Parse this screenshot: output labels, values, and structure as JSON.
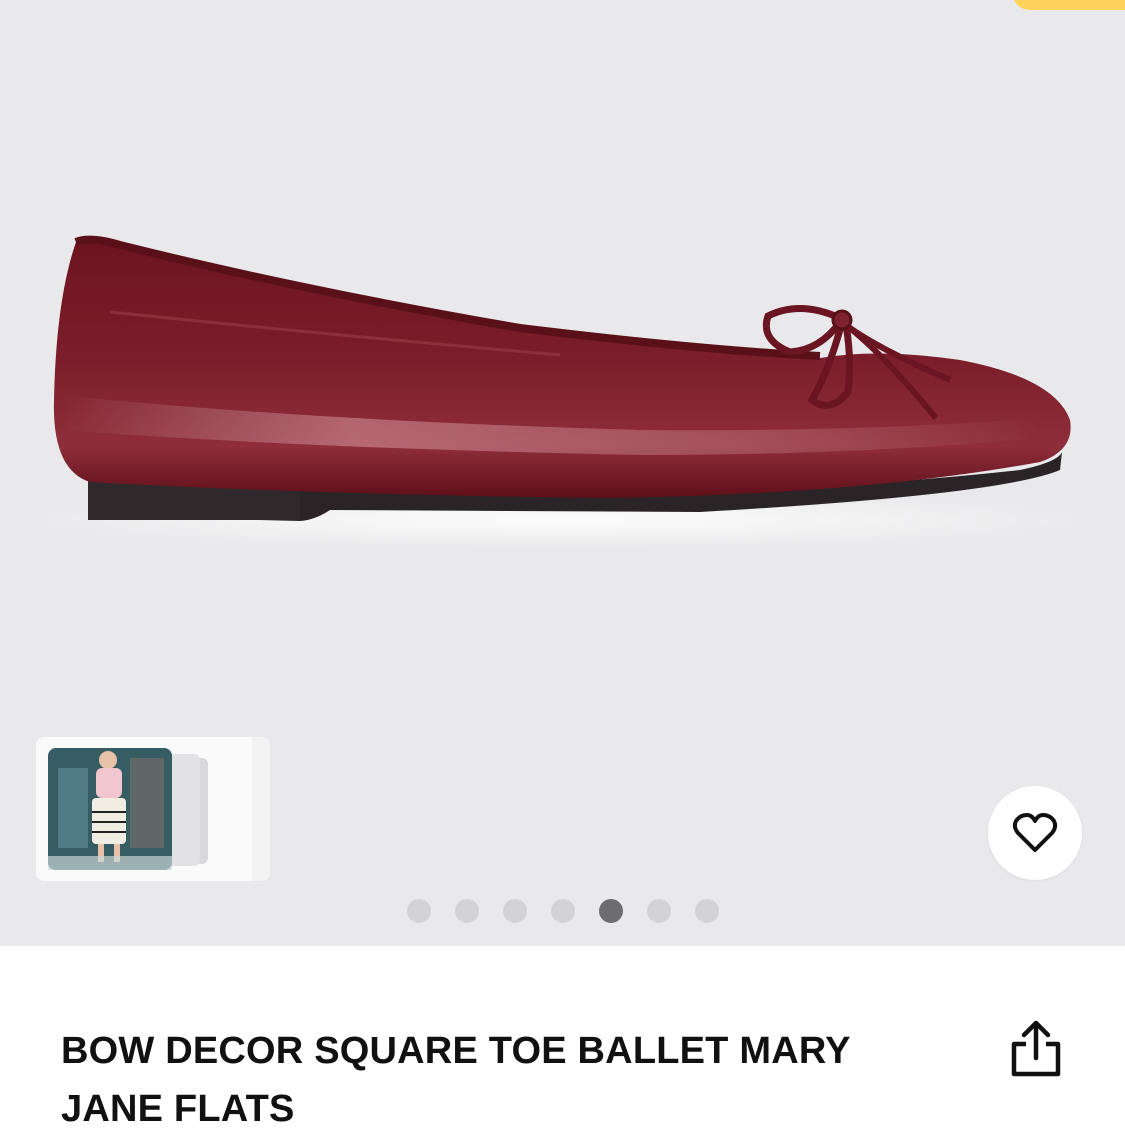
{
  "product": {
    "title": "BOW DECOR SQUARE TOE BALLET MARY JANE FLATS",
    "image": "burgundy-patent-ballet-flat-side-view",
    "color": "#7a1c28"
  },
  "gallery": {
    "thumbnail": "model-outfit-photo",
    "more_icon": "chevron-right-icon",
    "dots_total": 7,
    "active_dot_index": 4,
    "background": "#e9e9eb"
  },
  "actions": {
    "favorite_icon": "heart-icon",
    "share_icon": "share-icon"
  },
  "colors": {
    "accent": "#ffd35a",
    "dot_inactive": "#d3d3d6",
    "dot_active": "#6d6d70"
  }
}
